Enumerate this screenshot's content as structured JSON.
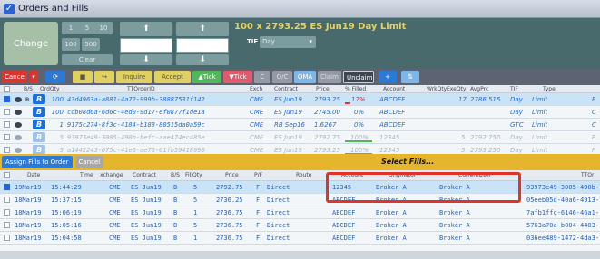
{
  "window": {
    "title": "Orders and Fills"
  },
  "entry": {
    "change_label": "Change",
    "qty_buttons": [
      "1",
      "5",
      "10",
      "100",
      "500"
    ],
    "clear_label": "Clear",
    "up_arrow": "⬆",
    "down_arrow": "⬇",
    "order_summary": "100 x 2793.25 ES Jun19 Day Limit",
    "tif_label": "TIF",
    "tif_value": "Day",
    "tif_dropdown": "▾"
  },
  "toolbar": {
    "cancel": "Cancel",
    "cancel_dd": "▾",
    "refresh": "⟳",
    "stop": "■",
    "redo": "↪",
    "inquire": "Inquire",
    "accept": "Accept",
    "up_tick": "▲Tick",
    "down_tick": "▼Tick",
    "c": "C",
    "oc": "O/C",
    "oma": "OMA",
    "claim": "Claim",
    "unclaim": "Unclaim",
    "plus": "+",
    "extra": "⇅"
  },
  "orders": {
    "headers": [
      "B/S",
      "OrdQty",
      "TTOrderID",
      "Exch",
      "Contract",
      "Price",
      "% Filled",
      "Account",
      "WrkQty",
      "ExeQty",
      "AvgPrc",
      "TIF",
      "Type"
    ],
    "rows": [
      {
        "side": "B",
        "qty": "100",
        "id": "43d4963a-a881-4a72-999b-38887531f142",
        "exch": "CME",
        "contract": "ES Jun19",
        "price": "2793.25",
        "filled": "17%",
        "account": "ABCDEF",
        "wrk": "",
        "exe": "17",
        "avg": "2786.515",
        "tif": "Day",
        "type": "Limit",
        "extra": "F"
      },
      {
        "side": "B",
        "qty": "100",
        "id": "cdb08d6a-6d6c-4ed0-9d17-ef0877f1de1a",
        "exch": "CME",
        "contract": "ES Jun19",
        "price": "2745.00",
        "filled": "0%",
        "account": "ABCDEF",
        "wrk": "",
        "exe": "",
        "avg": "",
        "tif": "Day",
        "type": "Limit",
        "extra": "C"
      },
      {
        "side": "B",
        "qty": "1",
        "id": "9175c274-8f3c-4184-b188-80515da0a59c",
        "exch": "CME",
        "contract": "RB Sep16",
        "price": "1.6267",
        "filled": "0%",
        "account": "ABCDEF",
        "wrk": "",
        "exe": "",
        "avg": "",
        "tif": "GTC",
        "type": "Limit",
        "extra": "C"
      },
      {
        "side": "B",
        "qty": "5",
        "id": "93973e49-3005-490b-befc-aae474ec485e",
        "exch": "CME",
        "contract": "ES Jun19",
        "price": "2792.75",
        "filled": "100%",
        "account": "12345",
        "wrk": "",
        "exe": "5",
        "avg": "2792.750",
        "tif": "Day",
        "type": "Limit",
        "extra": "F"
      },
      {
        "side": "B",
        "qty": "5",
        "id": "a1442243-075c-41e6-ae76-01fb59418990",
        "exch": "CME",
        "contract": "ES Jun19",
        "price": "2793.25",
        "filled": "100%",
        "account": "12345",
        "wrk": "",
        "exe": "5",
        "avg": "2793.250",
        "tif": "Day",
        "type": "Limit",
        "extra": "F"
      }
    ]
  },
  "fills_bar": {
    "assign_label": "Assign Fills to Order",
    "cancel_label": "Cancel",
    "select_fills": "Select Fills..."
  },
  "fills": {
    "headers": [
      "Date",
      "Time",
      "xchange",
      "Contract",
      "B/S",
      "FillQty",
      "Price",
      "P/F",
      "Route",
      "Account",
      "Originator",
      "CurrentUser",
      "TTOr"
    ],
    "rows": [
      {
        "date": "19Mar19",
        "time": "15:44:29",
        "exch": "CME",
        "contract": "ES Jun19",
        "side": "B",
        "qty": "5",
        "price": "2792.75",
        "pf": "F",
        "route": "Direct",
        "account": "12345",
        "orig": "Broker A",
        "user": "Broker A",
        "ttor": "93973e49-3005-490b-"
      },
      {
        "date": "18Mar19",
        "time": "15:37:15",
        "exch": "CME",
        "contract": "ES Jun19",
        "side": "B",
        "qty": "5",
        "price": "2736.25",
        "pf": "F",
        "route": "Direct",
        "account": "ABCDEF",
        "orig": "Broker A",
        "user": "Broker A",
        "ttor": "05eeb05d-40a6-4913-"
      },
      {
        "date": "18Mar19",
        "time": "15:06:19",
        "exch": "CME",
        "contract": "ES Jun19",
        "side": "B",
        "qty": "1",
        "price": "2736.75",
        "pf": "F",
        "route": "Direct",
        "account": "ABCDEF",
        "orig": "Broker A",
        "user": "Broker A",
        "ttor": "7afb1ffc-6146-46a1-"
      },
      {
        "date": "18Mar19",
        "time": "15:05:16",
        "exch": "CME",
        "contract": "ES Jun19",
        "side": "B",
        "qty": "5",
        "price": "2736.75",
        "pf": "F",
        "route": "Direct",
        "account": "ABCDEF",
        "orig": "Broker A",
        "user": "Broker A",
        "ttor": "5763a70a-b004-4403-"
      },
      {
        "date": "18Mar19",
        "time": "15:04:58",
        "exch": "CME",
        "contract": "ES Jun19",
        "side": "B",
        "qty": "1",
        "price": "2736.75",
        "pf": "F",
        "route": "Direct",
        "account": "ABCDEF",
        "orig": "Broker A",
        "user": "Broker A",
        "ttor": "036ee489-1472-4da3-"
      }
    ]
  },
  "colors": {
    "accent": "#2d7ad6",
    "highlight": "#e0332c",
    "fills_bar": "#e5b52e"
  }
}
